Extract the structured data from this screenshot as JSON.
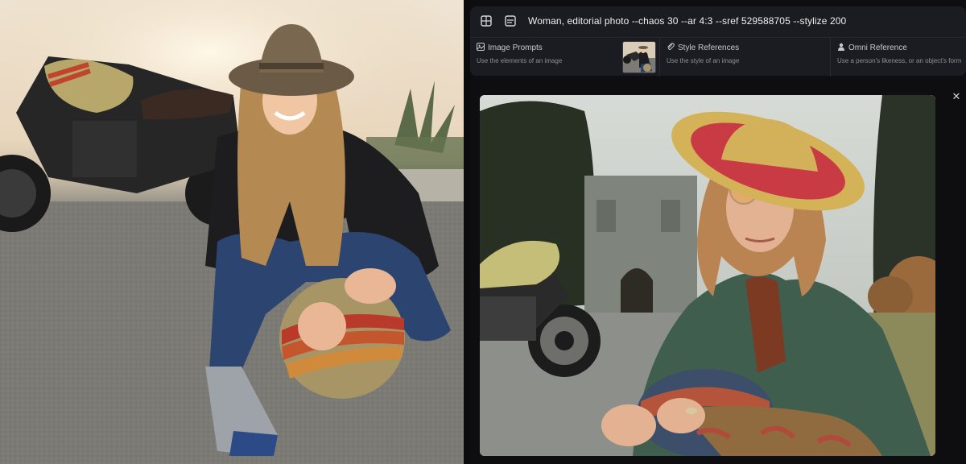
{
  "prompt": {
    "text": "Woman, editorial photo --chaos 30 --ar 4:3 --sref 529588705 --stylize 200",
    "image_icon": "image-icon",
    "attach_icon": "image-prompt-icon"
  },
  "references": [
    {
      "icon": "image-icon",
      "title": "Image Prompts",
      "subtitle": "Use the elements of an image"
    },
    {
      "icon": "paperclip-icon",
      "title": "Style References",
      "subtitle": "Use the style of an image"
    },
    {
      "icon": "person-icon",
      "title": "Omni Reference",
      "subtitle": "Use a person's likeness, or an object's form"
    }
  ],
  "close_icon": "close-icon",
  "colors": {
    "panel_bg": "#0e0e11",
    "bar_bg": "#1b1c21",
    "text_primary": "#f0f0f2",
    "text_secondary": "#8e8f96"
  }
}
